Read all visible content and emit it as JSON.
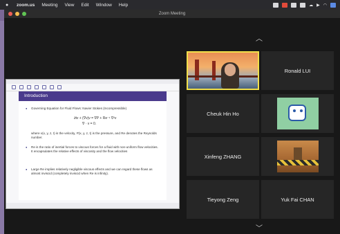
{
  "menubar": {
    "app": "zoom.us",
    "items": [
      "Meeting",
      "View",
      "Edit",
      "Window",
      "Help"
    ]
  },
  "window": {
    "title": "Zoom Meeting"
  },
  "slide": {
    "title": "Introduction",
    "bullets": [
      "Governing Equation for Fluid Flows: Navier Stokes (Incompressible)",
      "∂tv + (∇v)v = ∇P + Re⁻¹ ∇²v",
      "∇ · v = 0.",
      "where v(x, y, z, t) is the velocity, P(x, y, z, t) is the pressure, and Re denotes the Reynolds number.",
      "Re is the ratio of inertial forces to viscous forces for a fluid with non-uniform flow velocities. It encapsulates the relative effects of viscosity and the flow velocities",
      "Large Re implies relatively negligible viscous effects and we can regard these flows as almost inviscid (completely inviscid when Re is infinity)."
    ]
  },
  "participants": [
    {
      "name": ""
    },
    {
      "name": "Ronald LUI"
    },
    {
      "name": "Cheuk Hin Ho"
    },
    {
      "name": ""
    },
    {
      "name": "Xinfeng ZHANG"
    },
    {
      "name": ""
    },
    {
      "name": "Tieyong Zeng"
    },
    {
      "name": "Yuk Fai CHAN"
    }
  ],
  "colors": {
    "active_speaker_border": "#f2e04a",
    "slide_header": "#4a3a8c"
  }
}
